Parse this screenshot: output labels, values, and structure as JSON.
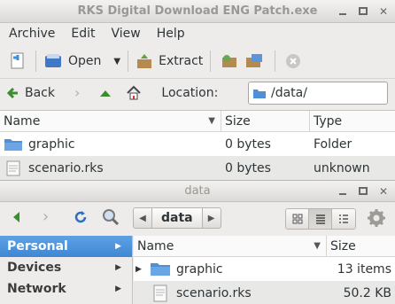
{
  "archive_window": {
    "title": "RKS Digital Download ENG Patch.exe",
    "menu": [
      "Archive",
      "Edit",
      "View",
      "Help"
    ],
    "toolbar": {
      "open_label": "Open",
      "extract_label": "Extract"
    },
    "nav": {
      "back_label": "Back",
      "location_label": "Location:",
      "location_value": "/data/"
    },
    "columns": {
      "name": "Name",
      "size": "Size",
      "type": "Type"
    },
    "rows": [
      {
        "name": "graphic",
        "size": "0 bytes",
        "type": "Folder",
        "icon": "folder-icon"
      },
      {
        "name": "scenario.rks",
        "size": "0 bytes",
        "type": "unknown",
        "icon": "file-icon"
      }
    ]
  },
  "file_window": {
    "title": "data",
    "path_crumb": "data",
    "sidebar": [
      "Personal",
      "Devices",
      "Network"
    ],
    "columns": {
      "name": "Name",
      "size": "Size"
    },
    "rows": [
      {
        "name": "graphic",
        "size": "13 items",
        "icon": "folder-icon"
      },
      {
        "name": "scenario.rks",
        "size": "50.2 KB",
        "icon": "file-icon"
      }
    ]
  },
  "colors": {
    "selection": "#4a90d9",
    "folder": "#4f8fd6"
  }
}
